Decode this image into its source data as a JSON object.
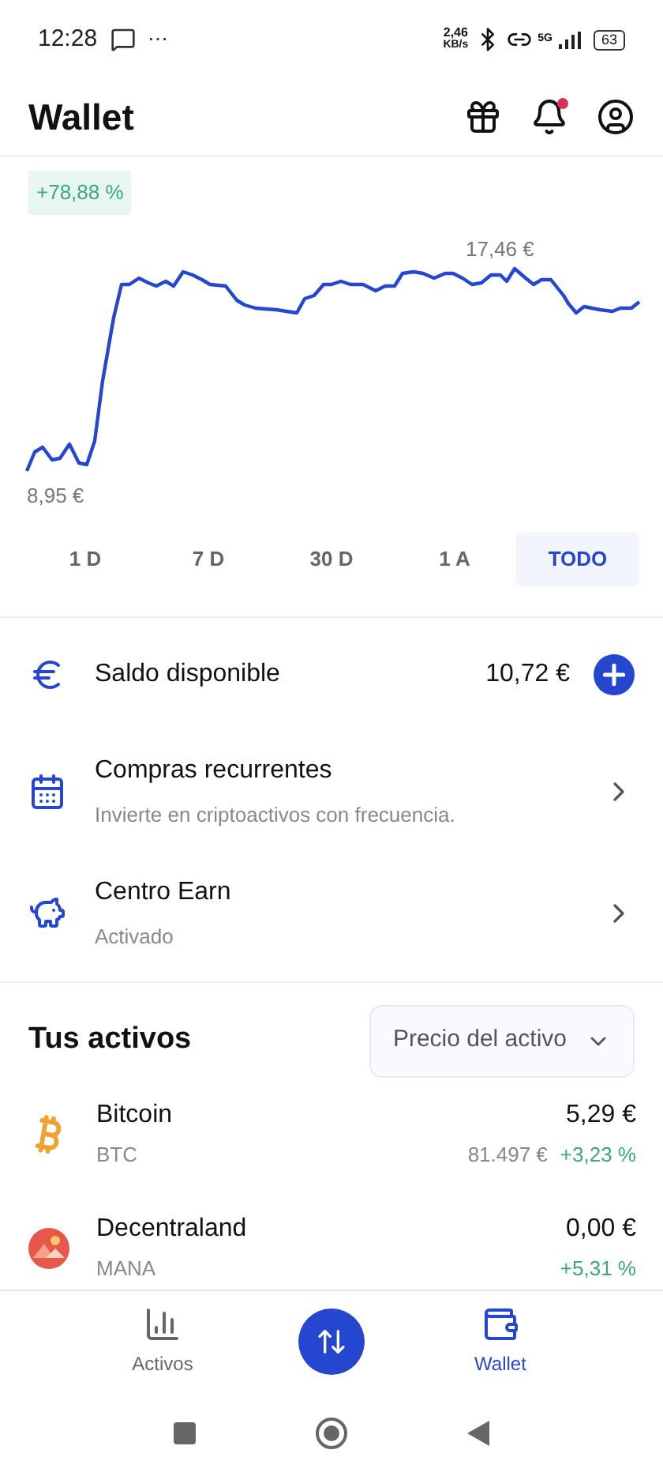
{
  "status_bar": {
    "time": "12:28",
    "more": "⋯",
    "speed_value": "2,46",
    "speed_unit": "KB/s",
    "network": "5G",
    "battery": "63"
  },
  "header": {
    "title": "Wallet",
    "notification_dot": true
  },
  "performance": {
    "change": "+78,88 %",
    "max_label": "17,46 €",
    "min_label": "8,95 €"
  },
  "ranges": [
    {
      "label": "1 D",
      "selected": false
    },
    {
      "label": "7 D",
      "selected": false
    },
    {
      "label": "30 D",
      "selected": false
    },
    {
      "label": "1 A",
      "selected": false
    },
    {
      "label": "TODO",
      "selected": true
    }
  ],
  "balance": {
    "label": "Saldo disponible",
    "amount": "10,72 €"
  },
  "menu": [
    {
      "kind": "calendar",
      "title": "Compras recurrentes",
      "subtitle": "Invierte en criptoactivos con frecuencia."
    },
    {
      "kind": "piggy",
      "title": "Centro Earn",
      "subtitle": "Activado"
    }
  ],
  "assets": {
    "title": "Tus activos",
    "sort": "Precio del activo",
    "items": [
      {
        "kind": "bitcoin",
        "name": "Bitcoin",
        "symbol": "BTC",
        "value": "5,29 €",
        "price": "81.497 €",
        "change": "+3,23 %"
      },
      {
        "kind": "mana",
        "name": "Decentraland",
        "symbol": "MANA",
        "value": "0,00 €",
        "change": "+5,31 %"
      }
    ]
  },
  "bottom_nav": [
    {
      "kind": "chart",
      "label": "Activos",
      "selected": false
    },
    {
      "kind": "swap",
      "selected": false
    },
    {
      "kind": "wallet",
      "label": "Wallet",
      "selected": true
    }
  ]
}
